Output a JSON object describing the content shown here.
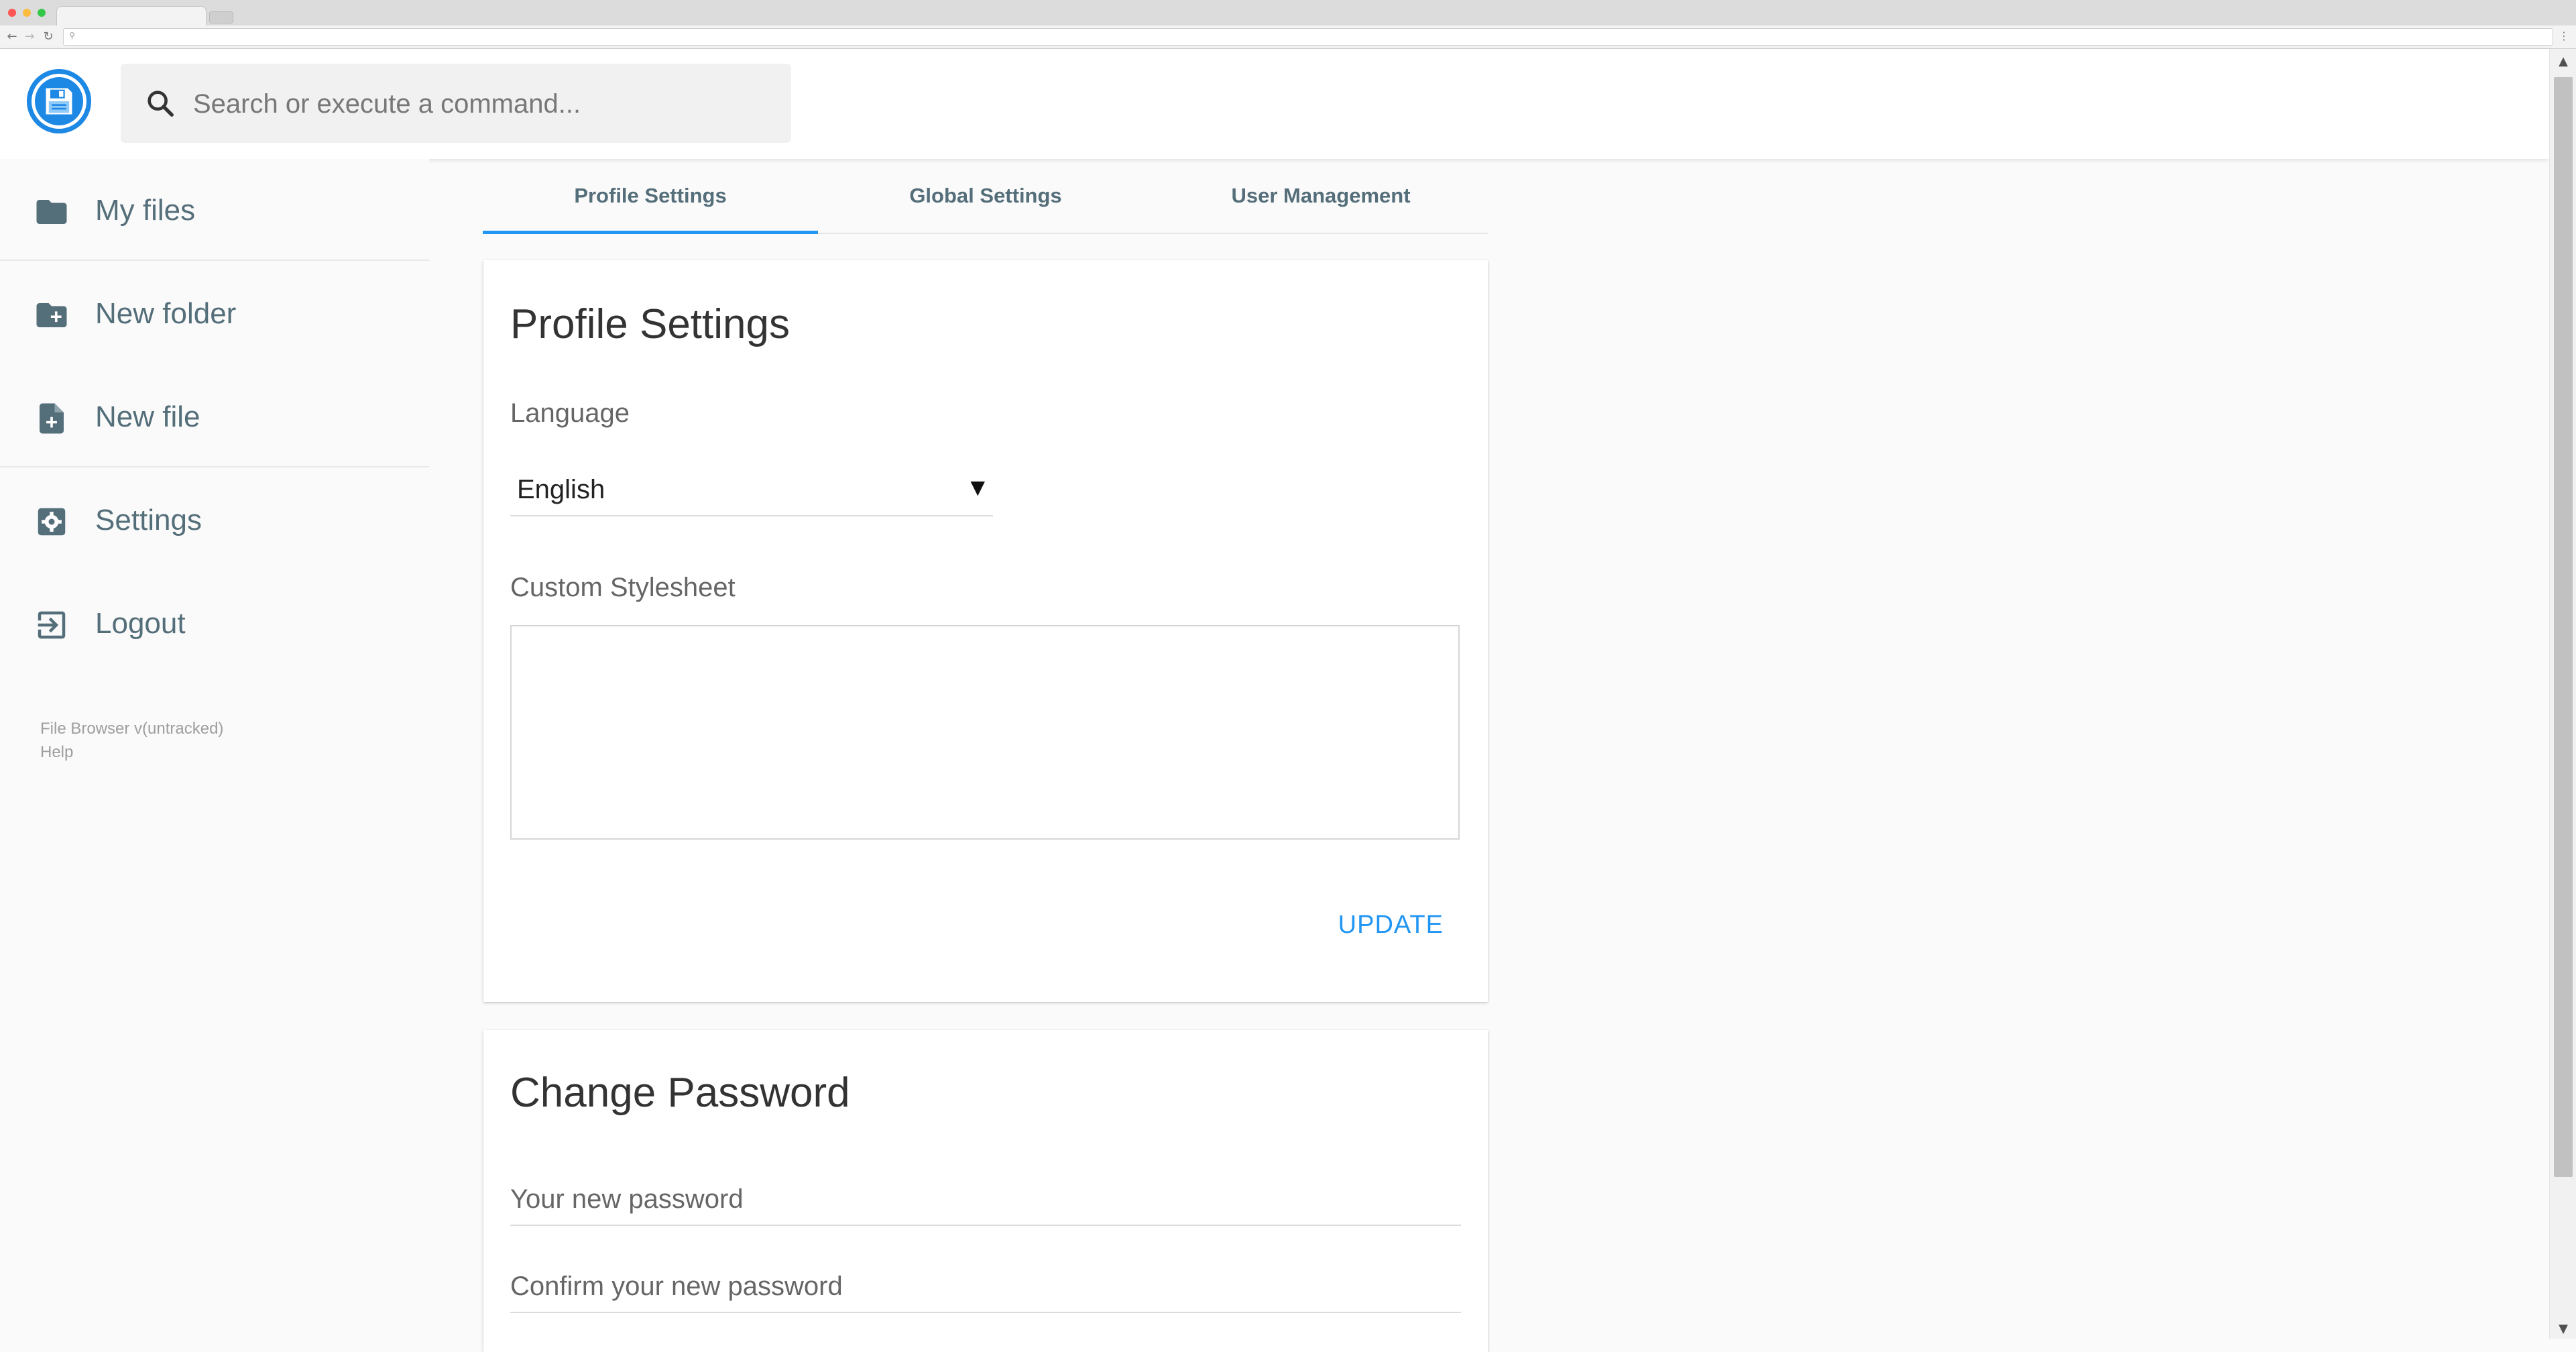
{
  "app": {
    "search_placeholder": "Search or execute a command..."
  },
  "sidebar": {
    "items": [
      {
        "label": "My files",
        "icon": "folder-icon"
      },
      {
        "label": "New folder",
        "icon": "folder-add-icon"
      },
      {
        "label": "New file",
        "icon": "file-add-icon"
      },
      {
        "label": "Settings",
        "icon": "settings-icon"
      },
      {
        "label": "Logout",
        "icon": "logout-icon"
      }
    ],
    "credits": {
      "version": "File Browser v(untracked)",
      "help": "Help"
    }
  },
  "tabs": [
    {
      "label": "Profile Settings",
      "active": true
    },
    {
      "label": "Global Settings",
      "active": false
    },
    {
      "label": "User Management",
      "active": false
    }
  ],
  "profile": {
    "title": "Profile Settings",
    "language_label": "Language",
    "language_value": "English",
    "stylesheet_label": "Custom Stylesheet",
    "stylesheet_value": "",
    "update_label": "UPDATE"
  },
  "password": {
    "title": "Change Password",
    "new_placeholder": "Your new password",
    "confirm_placeholder": "Confirm your new password"
  },
  "colors": {
    "accent": "#2196f3",
    "icon": "#546e7a",
    "logo": "#1e88e5"
  }
}
